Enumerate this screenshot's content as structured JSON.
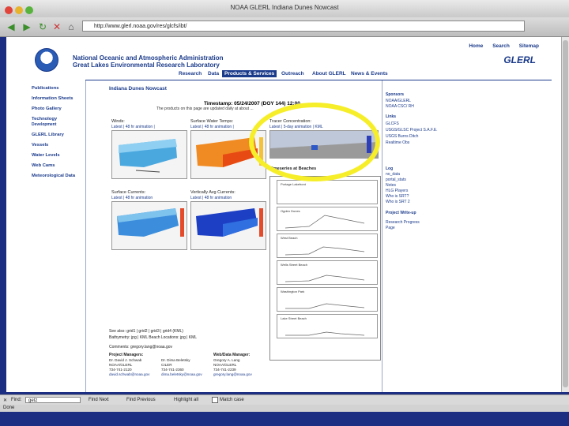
{
  "window": {
    "title": "NOAA GLERL Indiana Dunes Nowcast",
    "url": "http://www.glerl.noaa.gov/res/glcfs/ibt/"
  },
  "site": {
    "top_links": [
      "Home",
      "Search",
      "Sitemap"
    ],
    "org_line1": "National Oceanic and Atmospheric Administration",
    "org_line2": "Great Lakes Environmental Research Laboratory",
    "logo_text": "GLERL",
    "menu": [
      "Research",
      "Data",
      "Products & Services",
      "Outreach",
      "About GLERL",
      "News & Events"
    ],
    "active_menu": "Products & Services"
  },
  "left_nav": [
    {
      "label": "Publications"
    },
    {
      "label": "Information Sheets"
    },
    {
      "label": "Photo Gallery"
    },
    {
      "label": "Technology"
    },
    {
      "label": "Development",
      "sub": true
    },
    {
      "label": "GLERL Library"
    },
    {
      "label": "Vessels"
    },
    {
      "label": "Water Levels"
    },
    {
      "label": "Web Cams"
    },
    {
      "label": "Meteorological Data"
    }
  ],
  "page": {
    "title": "Indiana Dunes Nowcast",
    "timestamp": "Timestamp: 05/24/2007 (DOY 144) 12:00 ...",
    "subtitle": "The products on this page are updated daily at about ...",
    "panels": [
      {
        "title": "Winds:",
        "links": "Latest | 48 hr animation |"
      },
      {
        "title": "Surface Water Temps:",
        "links": "Latest | 48 hr animation |"
      },
      {
        "title": "Tracer Concentration:",
        "links": "Latest | 5-day animation | KML"
      },
      {
        "title": "Surface Currents:",
        "links": "Latest | 48 hr animation"
      },
      {
        "title": "Vertically Avg Currents:",
        "links": "Latest | 48 hr animation"
      }
    ],
    "timeseries_title": "Timeseries at Beaches",
    "timeseries_plots": [
      "Portage Lakefront",
      "Ogden Dunes",
      "West Beach",
      "Wells Street Beach",
      "Washington Park",
      "Lake Street Beach"
    ],
    "see_also": "See also: grid1 | grid2 | grid3 | grid4 (KML)",
    "bathymetry": "Bathymetry: jpg | KML    Beach Locations: jpg | KML",
    "comments": "Comments: gregory.lang@noaa.gov",
    "project_managers_label": "Project Managers:",
    "pm_lines": [
      "Dr. David J. Schwab",
      "NOAA/GLERL",
      "734-741-2120",
      "david.schwab@noaa.gov"
    ],
    "pm2_lines": [
      "Dr. Dima Beletsky",
      "CILER",
      "734-741-2360",
      "dima.beletsky@noaa.gov"
    ],
    "webdata_label": "Web/Data Manager:",
    "wd_lines": [
      "Gregory A. Lang",
      "NOAA/GLERL",
      "734-741-2239",
      "gregory.lang@noaa.gov"
    ]
  },
  "right_nav": [
    {
      "label": "Sponsors",
      "head": true
    },
    {
      "label": "NOAA/GLERL"
    },
    {
      "label": "NOAA CSC/ RH"
    },
    {
      "label": "Links",
      "head": true
    },
    {
      "label": "GLCFS"
    },
    {
      "label": "USGS/GLSC Project S.A.F.E."
    },
    {
      "label": "USGS Burns Ditch"
    },
    {
      "label": "Realtime Obs"
    },
    {
      "label": "Log",
      "head": true
    },
    {
      "label": "no_data"
    },
    {
      "label": "portal_stats"
    },
    {
      "label": "Notes"
    },
    {
      "label": "HLG Players"
    },
    {
      "label": "Who is SRT?"
    },
    {
      "label": "Who is SRT 2"
    },
    {
      "label": "Project Write-up",
      "head": true
    },
    {
      "label": "Research Progress"
    },
    {
      "label": "Page"
    }
  ],
  "findbar": {
    "label": "Find:",
    "value": "getz",
    "find_next": "Find Next",
    "find_prev": "Find Previous",
    "highlight": "Highlight all",
    "match_case": "Match case"
  },
  "status": "Done",
  "colors": {
    "navy": "#1a3a8a",
    "highlight": "#f6ee28",
    "frame": "#1c2e82"
  }
}
